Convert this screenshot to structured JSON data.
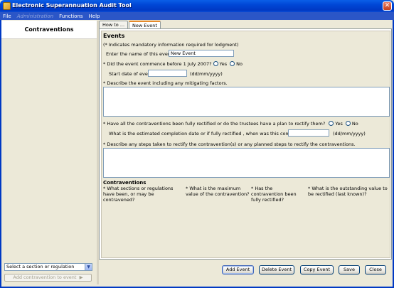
{
  "window": {
    "title": "Electronic Superannuation Audit Tool"
  },
  "menu": {
    "items": [
      "File",
      "Administration",
      "Functions",
      "Help"
    ]
  },
  "left_panel": {
    "header": "Contraventions",
    "section_select": "Select a section or regulation",
    "add_button": "Add contravention to event"
  },
  "tabs": [
    "How to ...",
    "New Event"
  ],
  "form": {
    "title": "Events",
    "mandatory_note": "(* Indicates mandatory information required for lodgment)",
    "event_name_label": "Enter the name of this event",
    "event_name_value": "New Event",
    "before_question": "* Did the event commence before 1 July  2007?",
    "yes": "Yes",
    "no": "No",
    "start_date_label": "Start date of event",
    "date_format": "(dd/mm/yyyy)",
    "describe_label": "* Describe the event including any mitigating factors.",
    "rectified_question": "* Have all the contraventions been fully rectified or do the trustees have a plan to rectify them?",
    "completion_label": "What is the estimated completion date or if fully rectified , when was this completed?",
    "steps_label": "* Describe any steps taken to rectify the contravention(s) or any planned steps to rectify the contraventions.",
    "contraventions_title": "Contraventions",
    "columns": [
      "* What sections or regulations have been, or may be contravened?",
      "* What is the maximum value of the contravention?",
      "* Has the contravention been fully rectified?",
      "* What is the outstanding value to be rectified (last known)?"
    ]
  },
  "buttons": {
    "add_event": "Add Event",
    "delete_event": "Delete Event",
    "copy_event": "Copy Event",
    "save": "Save",
    "close": "Close"
  }
}
